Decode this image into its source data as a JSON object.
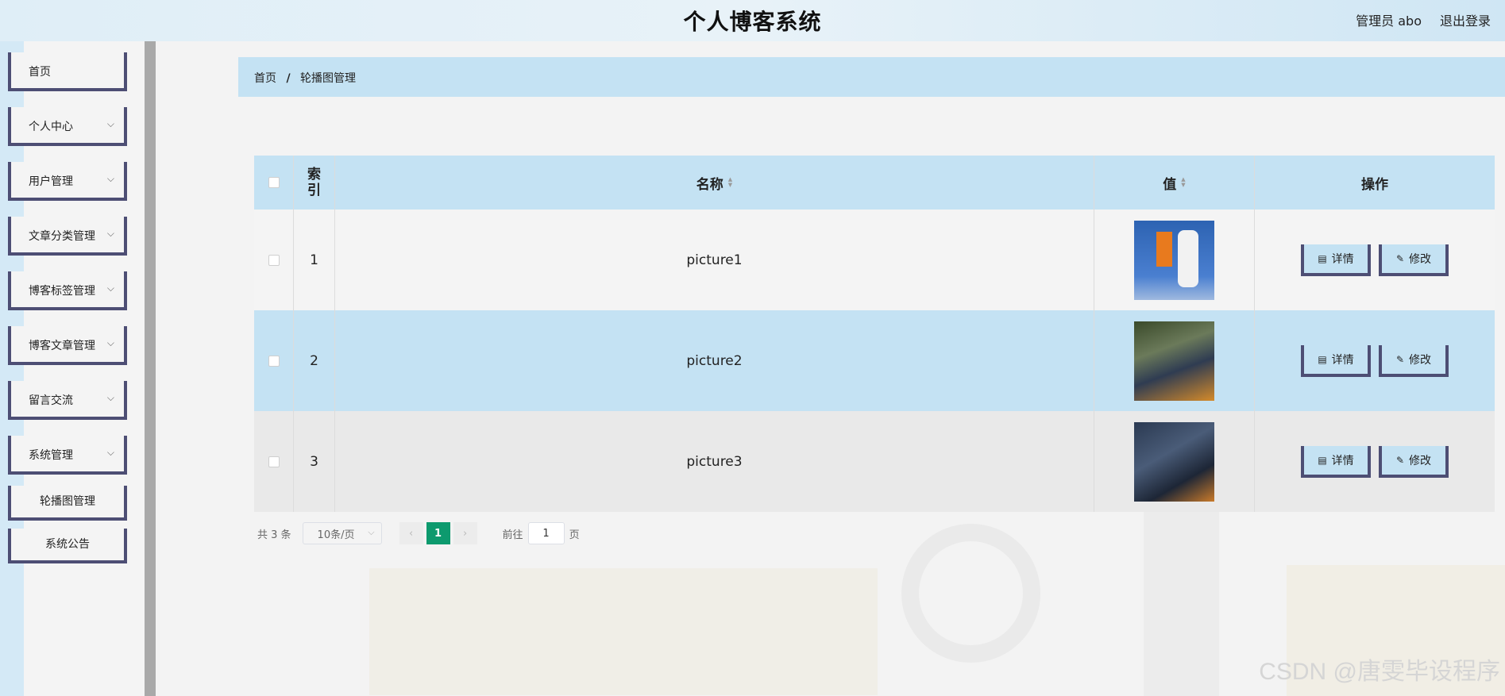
{
  "header": {
    "title": "个人博客系统",
    "user": "管理员 abo",
    "logout": "退出登录"
  },
  "sidebar": {
    "items": [
      {
        "label": "首页",
        "has_arrow": false
      },
      {
        "label": "个人中心",
        "has_arrow": true
      },
      {
        "label": "用户管理",
        "has_arrow": true
      },
      {
        "label": "文章分类管理",
        "has_arrow": true
      },
      {
        "label": "博客标签管理",
        "has_arrow": true
      },
      {
        "label": "博客文章管理",
        "has_arrow": true
      },
      {
        "label": "留言交流",
        "has_arrow": true
      },
      {
        "label": "系统管理",
        "has_arrow": true
      }
    ],
    "subitems": [
      {
        "label": "轮播图管理"
      },
      {
        "label": "系统公告"
      }
    ]
  },
  "breadcrumb": {
    "home": "首页",
    "separator": "/",
    "current": "轮播图管理"
  },
  "table": {
    "headers": {
      "index": "索引",
      "name": "名称",
      "value": "值",
      "ops": "操作"
    },
    "rows": [
      {
        "index": "1",
        "name": "picture1"
      },
      {
        "index": "2",
        "name": "picture2"
      },
      {
        "index": "3",
        "name": "picture3"
      }
    ],
    "buttons": {
      "detail": "详情",
      "edit": "修改"
    }
  },
  "pagination": {
    "total": "共 3 条",
    "page_size": "10条/页",
    "current_page": "1",
    "goto_prefix": "前往",
    "goto_value": "1",
    "goto_suffix": "页"
  },
  "watermark": "CSDN @唐雯毕设程序"
}
